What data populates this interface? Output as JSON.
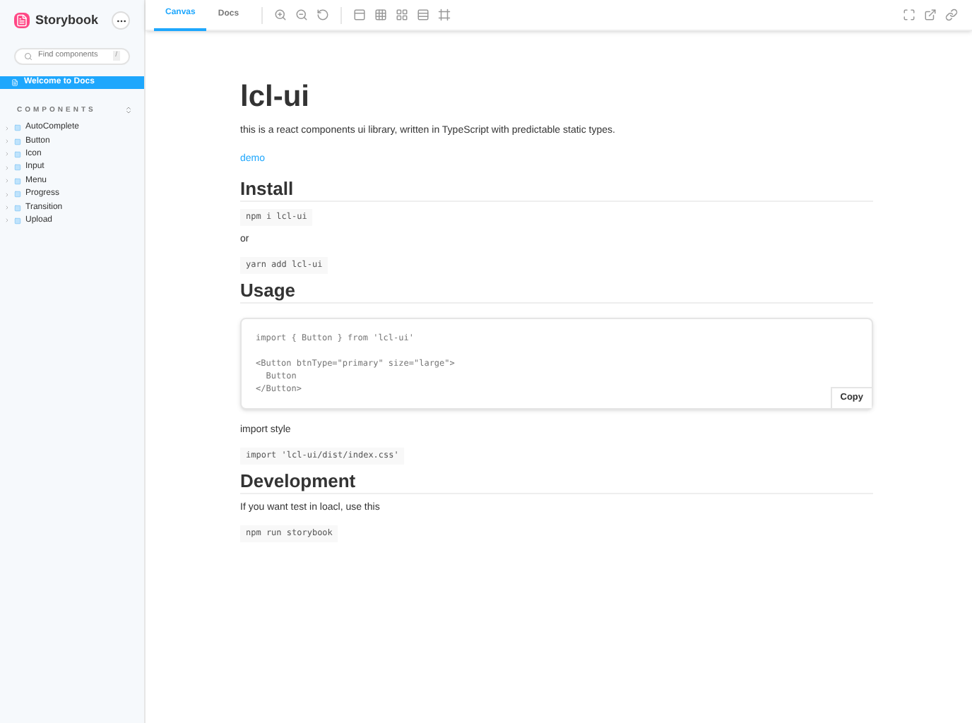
{
  "sidebar": {
    "brand": "Storybook",
    "search": {
      "placeholder": "Find components",
      "shortcut": "/"
    },
    "docs_item": {
      "label": "Welcome to Docs",
      "selected": true
    },
    "section": {
      "title": "COMPONENTS",
      "items": [
        {
          "label": "AutoComplete",
          "expanded": false
        },
        {
          "label": "Button",
          "expanded": false
        },
        {
          "label": "Icon",
          "expanded": false
        },
        {
          "label": "Input",
          "expanded": false
        },
        {
          "label": "Menu",
          "expanded": false
        },
        {
          "label": "Progress",
          "expanded": false
        },
        {
          "label": "Transition",
          "expanded": false
        },
        {
          "label": "Upload",
          "expanded": false
        }
      ]
    }
  },
  "tabs": [
    {
      "label": "Canvas",
      "selected": true
    },
    {
      "label": "Docs",
      "selected": false
    }
  ],
  "content": [
    {
      "kind": "title",
      "text": "lcl-ui"
    },
    {
      "kind": "paragraph",
      "text": "this is a react components ui library, written in TypeScript with predictable static types."
    },
    {
      "kind": "link",
      "text": "demo"
    },
    {
      "kind": "heading",
      "text": "Install"
    },
    {
      "kind": "code",
      "text": "npm i lcl-ui"
    },
    {
      "kind": "paragraph",
      "text": "or"
    },
    {
      "kind": "code",
      "text": "yarn add lcl-ui"
    },
    {
      "kind": "heading",
      "text": "Usage"
    },
    {
      "kind": "codeblock",
      "groups": [
        [
          "import { Button } from 'lcl-ui'"
        ],
        [
          "<Button btnType=\"primary\" size=\"large\">",
          "  Button",
          "</Button>"
        ]
      ],
      "button": "Copy"
    },
    {
      "kind": "paragraph",
      "text": "import style"
    },
    {
      "kind": "code",
      "text": "import 'lcl-ui/dist/index.css'"
    },
    {
      "kind": "heading",
      "text": "Development"
    },
    {
      "kind": "paragraph",
      "text": "If you want test in loacl, use this"
    },
    {
      "kind": "code",
      "text": "npm run storybook"
    }
  ]
}
